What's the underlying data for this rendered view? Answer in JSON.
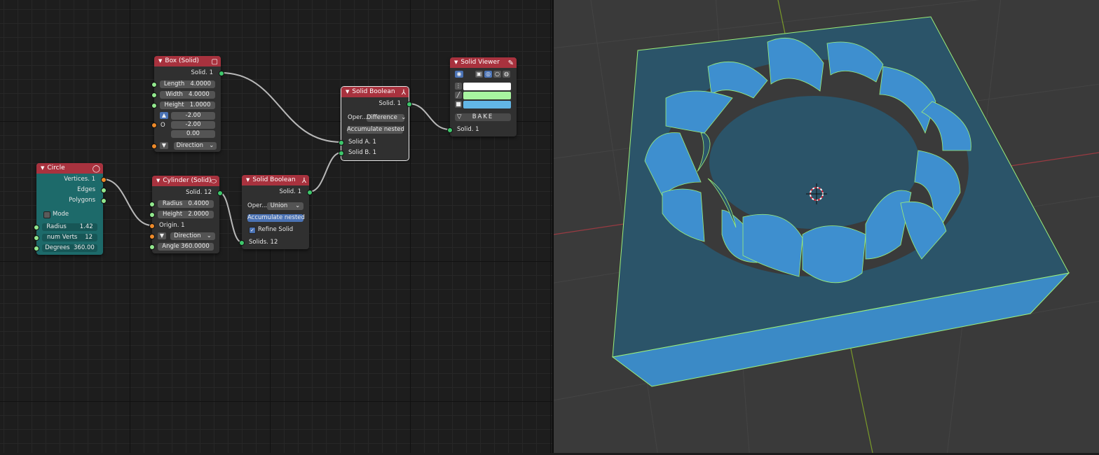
{
  "colors": {
    "node_header_solid": "#a8323e",
    "node_circle_body": "#1d6a6a",
    "socket_solid": "#3ec76b",
    "socket_vector": "#ed8a2a",
    "socket_number": "#92e88e",
    "viewport_bg": "#3a3a3a",
    "mesh_face": "#3d8ac8"
  },
  "nodes": {
    "box": {
      "title": "Box (Solid)",
      "icon": "box-icon",
      "output": "Solid. 1",
      "length_label": "Length",
      "length_value": "4.0000",
      "width_label": "Width",
      "width_value": "4.0000",
      "height_label": "Height",
      "height_value": "1.0000",
      "origin_label": "O",
      "origin_x": "-2.00",
      "origin_y": "-2.00",
      "origin_z": "0.00",
      "direction": "Direction"
    },
    "circle": {
      "title": "Circle",
      "icon": "circle-icon",
      "out_vertices": "Vertices. 1",
      "out_edges": "Edges",
      "out_polygons": "Polygons",
      "mode_label": "Mode",
      "radius_label": "Radius",
      "radius_value": "1.42",
      "verts_label": "num Verts",
      "verts_value": "12",
      "degrees_label": "Degrees",
      "degrees_value": "360.00"
    },
    "cylinder": {
      "title": "Cylinder (Solid)",
      "icon": "cylinder-icon",
      "output": "Solid. 12",
      "radius_label": "Radius",
      "radius_value": "0.4000",
      "height_label": "Height",
      "height_value": "2.0000",
      "origin": "Origin. 1",
      "direction": "Direction",
      "angle_label": "Angle",
      "angle_value": "360.0000"
    },
    "boolean_union": {
      "title": "Solid Boolean",
      "icon": "boolean-icon",
      "output": "Solid. 1",
      "operation_label": "Oper...",
      "operation_value": "Union",
      "accumulate": "Accumulate nested",
      "refine": "Refine Solid",
      "input": "Solids. 12"
    },
    "boolean_difference": {
      "title": "Solid Boolean",
      "icon": "boolean-icon",
      "output": "Solid. 1",
      "operation_label": "Oper...",
      "operation_value": "Difference",
      "accumulate": "Accumulate nested",
      "input_a": "Solid A. 1",
      "input_b": "Solid B. 1"
    },
    "viewer": {
      "title": "Solid Viewer",
      "icon": "pencil-icon",
      "bake": "BAKE",
      "input": "Solid. 1",
      "swatch_vertex": "#ffffff",
      "swatch_edge": "#a8f5a0",
      "swatch_face": "#62b6e6"
    }
  }
}
